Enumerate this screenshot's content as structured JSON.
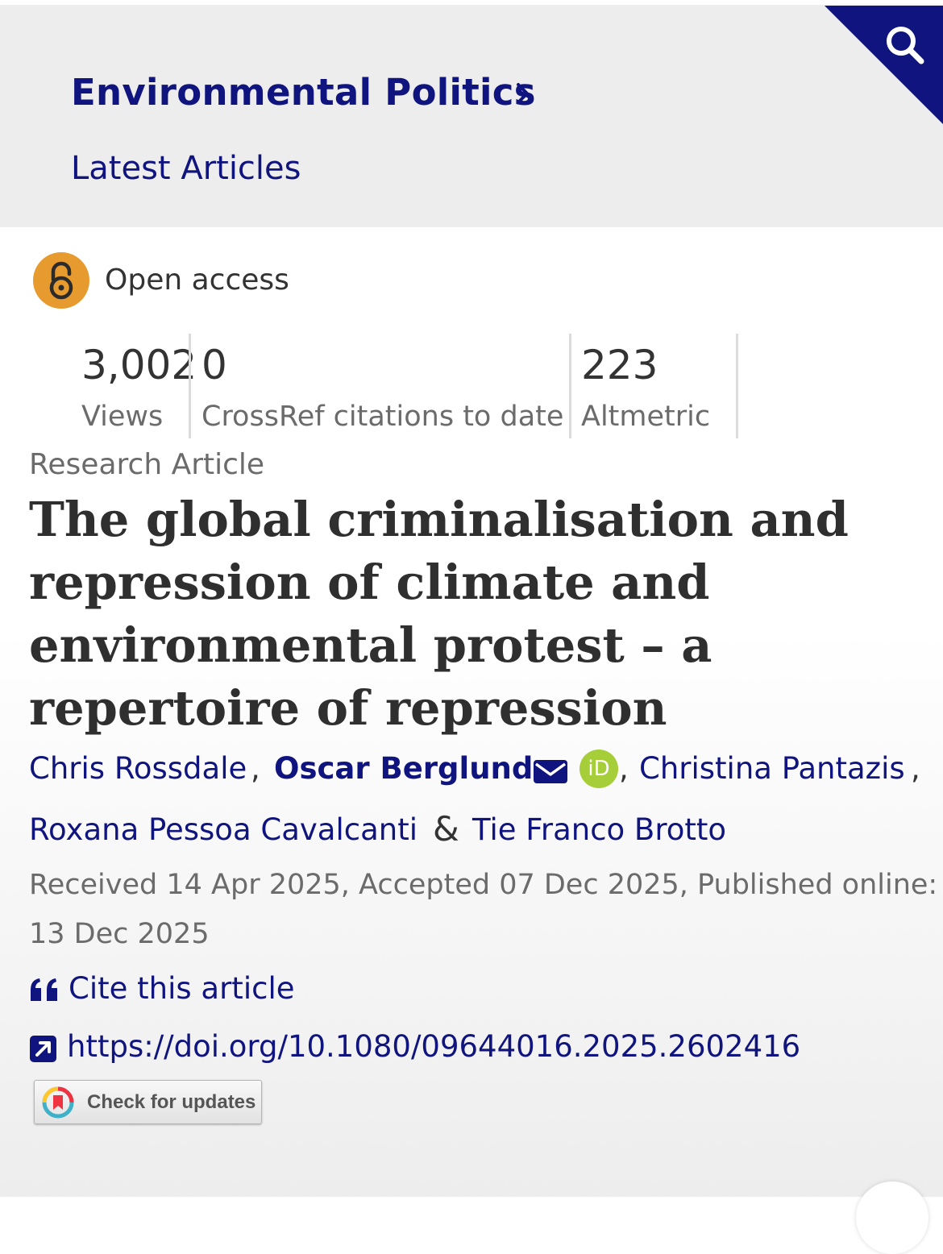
{
  "header": {
    "journal_title": "Environmental Politics",
    "section_link": "Latest Articles"
  },
  "access": {
    "label": "Open access",
    "icon": "open-lock-icon",
    "color": "#e79a2e"
  },
  "metrics": [
    {
      "value": "3,002",
      "label": "Views"
    },
    {
      "value": "0",
      "label": "CrossRef citations to date"
    },
    {
      "value": "223",
      "label": "Altmetric"
    }
  ],
  "article": {
    "type": "Research Article",
    "title_lines": [
      "The global criminalisation and",
      "repression of climate and",
      "environmental protest – a",
      "repertoire of repression"
    ],
    "authors": [
      {
        "name": "Chris Rossdale"
      },
      {
        "name": "Oscar Berglund"
      },
      {
        "name": "Christina Pantazis"
      },
      {
        "name": "Roxana Pessoa Cavalcanti"
      },
      {
        "name": "Tie Franco Brotto"
      }
    ],
    "orcid_label": "iD",
    "separator_comma": ",",
    "separator_amp": "&",
    "dates_text": "Received 14 Apr 2025, Accepted 07 Dec 2025, Published online: 13 Dec 2025"
  },
  "actions": {
    "cite_label": "Cite this article",
    "doi": "https://doi.org/10.1080/09644016.2025.2602416",
    "check_updates_label": "Check for updates"
  },
  "colors": {
    "link": "#10147e",
    "header_bg": "#ededed",
    "orcid": "#a6ce39"
  }
}
